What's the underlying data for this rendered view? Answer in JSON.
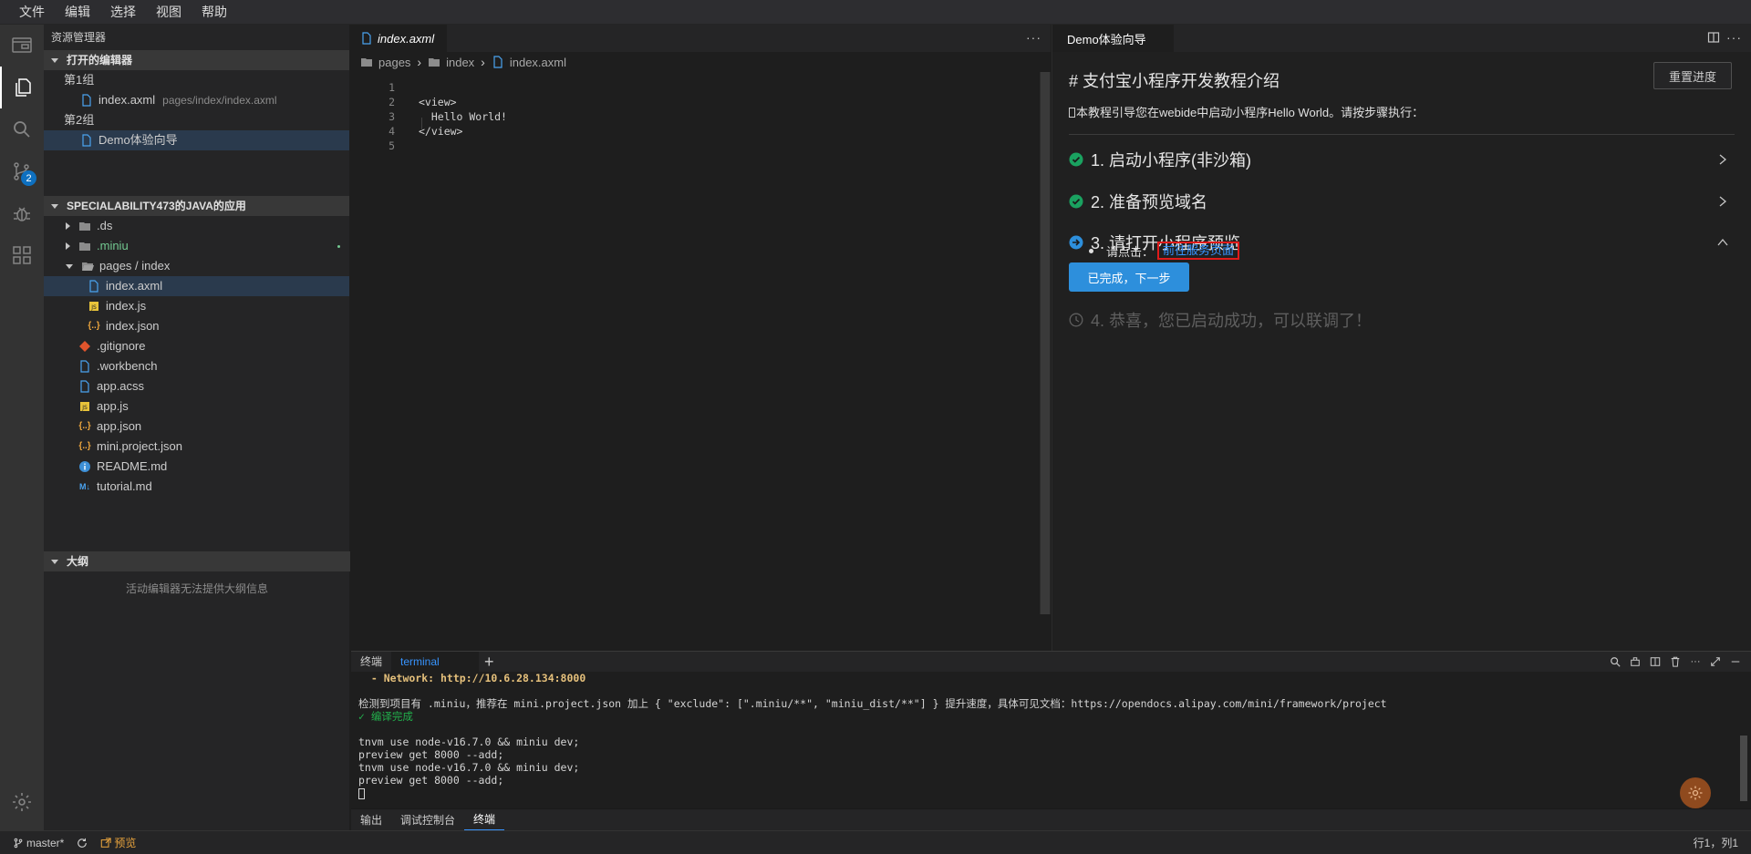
{
  "menubar": [
    "文件",
    "编辑",
    "选择",
    "视图",
    "帮助"
  ],
  "activity": {
    "scm_badge": "2"
  },
  "sidebar": {
    "title": "资源管理器",
    "open_editors": {
      "header": "打开的编辑器",
      "group1": "第1组",
      "group1_file": "index.axml",
      "group1_file_path": "pages/index/index.axml",
      "group2": "第2组",
      "group2_file": "Demo体验向导"
    },
    "project": {
      "header": "SPECIALABILITY473的JAVA的应用",
      "items": [
        {
          "label": ".ds",
          "kind": "folder"
        },
        {
          "label": ".miniu",
          "kind": "folder"
        },
        {
          "label": "pages / index",
          "kind": "folder-open"
        },
        {
          "label": "index.axml",
          "kind": "file"
        },
        {
          "label": "index.js",
          "kind": "js"
        },
        {
          "label": "index.json",
          "kind": "json"
        },
        {
          "label": ".gitignore",
          "kind": "git"
        },
        {
          "label": ".workbench",
          "kind": "file"
        },
        {
          "label": "app.acss",
          "kind": "file"
        },
        {
          "label": "app.js",
          "kind": "js"
        },
        {
          "label": "app.json",
          "kind": "json"
        },
        {
          "label": "mini.project.json",
          "kind": "json"
        },
        {
          "label": "README.md",
          "kind": "info"
        },
        {
          "label": "tutorial.md",
          "kind": "md"
        }
      ]
    },
    "outline": {
      "header": "大纲",
      "empty": "活动编辑器无法提供大纲信息"
    }
  },
  "editor": {
    "tab": "index.axml",
    "breadcrumb": [
      "pages",
      "index",
      "index.axml"
    ],
    "lines": [
      {
        "n": "1",
        "t": ""
      },
      {
        "n": "2",
        "t": "<view>"
      },
      {
        "n": "3",
        "t": "  Hello World!"
      },
      {
        "n": "4",
        "t": "</view>"
      },
      {
        "n": "5",
        "t": ""
      }
    ]
  },
  "preview": {
    "tab": "Demo体验向导",
    "heading": "# 支付宝小程序开发教程介绍",
    "reset": "重置进度",
    "intro": "本教程引导您在webide中启动小程序Hello World。请按步骤执行：",
    "steps": [
      {
        "label": "1. 启动小程序(非沙箱)",
        "state": "done"
      },
      {
        "label": "2. 准备预览域名",
        "state": "done"
      },
      {
        "label": "3. 请打开小程序预览",
        "state": "current"
      },
      {
        "label": "4. 恭喜，您已启动成功，可以联调了！",
        "state": "pending"
      }
    ],
    "click_prompt": "请点击：",
    "service_link": "前往服务页面",
    "next_button": "已完成，下一步"
  },
  "panel": {
    "title": "终端",
    "terminal_tab": "terminal",
    "lines": [
      {
        "text": "  - Network: http://10.6.28.134:8000",
        "style": "net"
      },
      {
        "text": "",
        "style": ""
      },
      {
        "text": "检测到项目有 .miniu，推荐在 mini.project.json 加上 { \"exclude\": [\".miniu/**\", \"miniu_dist/**\"] } 提升速度，具体可见文档：https://opendocs.alipay.com/mini/framework/project",
        "style": ""
      },
      {
        "text": "✓ 编译完成",
        "style": "ok"
      },
      {
        "text": "",
        "style": ""
      },
      {
        "text": "tnvm use node-v16.7.0 && miniu dev;",
        "style": ""
      },
      {
        "text": "preview get 8000 --add;",
        "style": ""
      },
      {
        "text": "tnvm use node-v16.7.0 && miniu dev;",
        "style": ""
      },
      {
        "text": "preview get 8000 --add;",
        "style": ""
      }
    ],
    "bottom_tabs": [
      "输出",
      "调试控制台",
      "终端"
    ]
  },
  "status": {
    "branch": "master*",
    "preview": "预览",
    "position": "行1，列1"
  },
  "colors": {
    "accent": "#2d8fdc",
    "link": "#3794ff",
    "step_done": "#1aa260",
    "step_current": "#2d8fdc"
  }
}
